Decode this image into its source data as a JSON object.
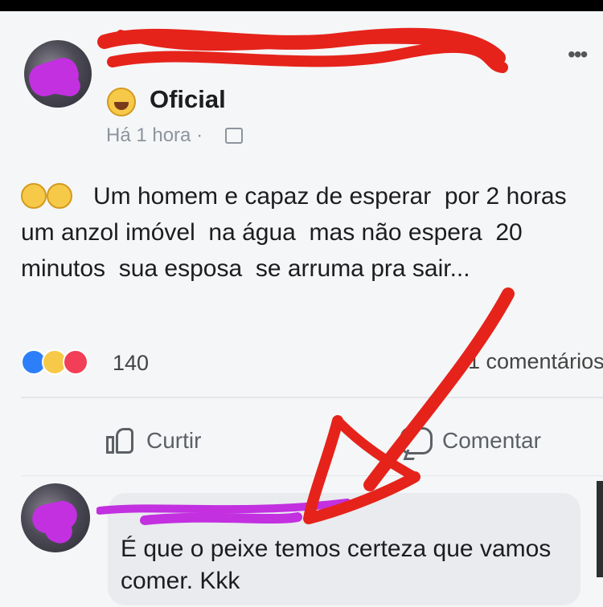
{
  "post": {
    "page_name": "Oficial",
    "timestamp": "Há 1 hora ·",
    "text": "Um homem e capaz de esperar  por 2 horas um anzol imóvel  na água  mas não espera  20 minutos  sua esposa  se arruma pra sair...",
    "reaction_count": "140",
    "comments_label": "1 comentários",
    "more_label": "•••"
  },
  "actions": {
    "like_label": "Curtir",
    "comment_label": "Comentar"
  },
  "comment": {
    "text": "É que o peixe temos certeza que vamos comer. Kkk"
  },
  "colors": {
    "redaction_red": "#e5231b",
    "redaction_purple": "#c230e0",
    "like_blue": "#2d7ff9",
    "haha_yellow": "#f7c948",
    "love_red": "#f33e58"
  }
}
